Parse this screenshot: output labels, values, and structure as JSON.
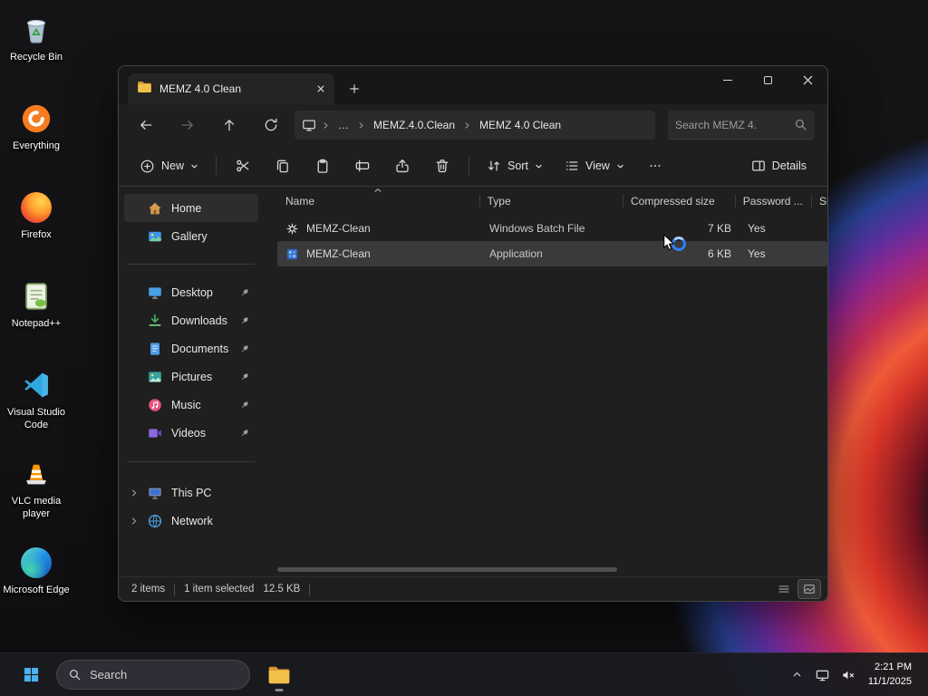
{
  "colors": {
    "accent": "#4cc2ff",
    "selection_row": "#3a3a3a",
    "folder_yellow": "#f3c14b",
    "spinner_blue": "#2e7ff2"
  },
  "desktop_icons": [
    {
      "label": "Recycle Bin"
    },
    {
      "label": "Everything"
    },
    {
      "label": "Firefox"
    },
    {
      "label": "Notepad++"
    },
    {
      "label": "Visual Studio Code"
    },
    {
      "label": "VLC media player"
    },
    {
      "label": "Microsoft Edge"
    }
  ],
  "window": {
    "tab_title": "MEMZ 4.0 Clean",
    "breadcrumb": {
      "overflow": "…",
      "crumb_parent": "MEMZ.4.0.Clean",
      "crumb_current": "MEMZ 4.0 Clean"
    },
    "search_placeholder": "Search MEMZ 4.",
    "toolbar": {
      "new_label": "New",
      "sort_label": "Sort",
      "view_label": "View",
      "details_label": "Details"
    },
    "sidebar": {
      "items": [
        {
          "label": "Home"
        },
        {
          "label": "Gallery"
        },
        {
          "label": "Desktop"
        },
        {
          "label": "Downloads"
        },
        {
          "label": "Documents"
        },
        {
          "label": "Pictures"
        },
        {
          "label": "Music"
        },
        {
          "label": "Videos"
        },
        {
          "label": "This PC"
        },
        {
          "label": "Network"
        }
      ]
    },
    "columns": {
      "name": "Name",
      "type": "Type",
      "compressed": "Compressed size",
      "password": "Password ...",
      "size": "Si"
    },
    "files": [
      {
        "name": "MEMZ-Clean",
        "type": "Windows Batch File",
        "compressed": "7 KB",
        "password": "Yes"
      },
      {
        "name": "MEMZ-Clean",
        "type": "Application",
        "compressed": "6 KB",
        "password": "Yes"
      }
    ],
    "statusbar": {
      "count": "2 items",
      "selected": "1 item selected",
      "size": "12.5 KB"
    }
  },
  "taskbar": {
    "search_label": "Search",
    "clock": {
      "time": "2:21 PM",
      "date": "11/1/2025"
    }
  }
}
